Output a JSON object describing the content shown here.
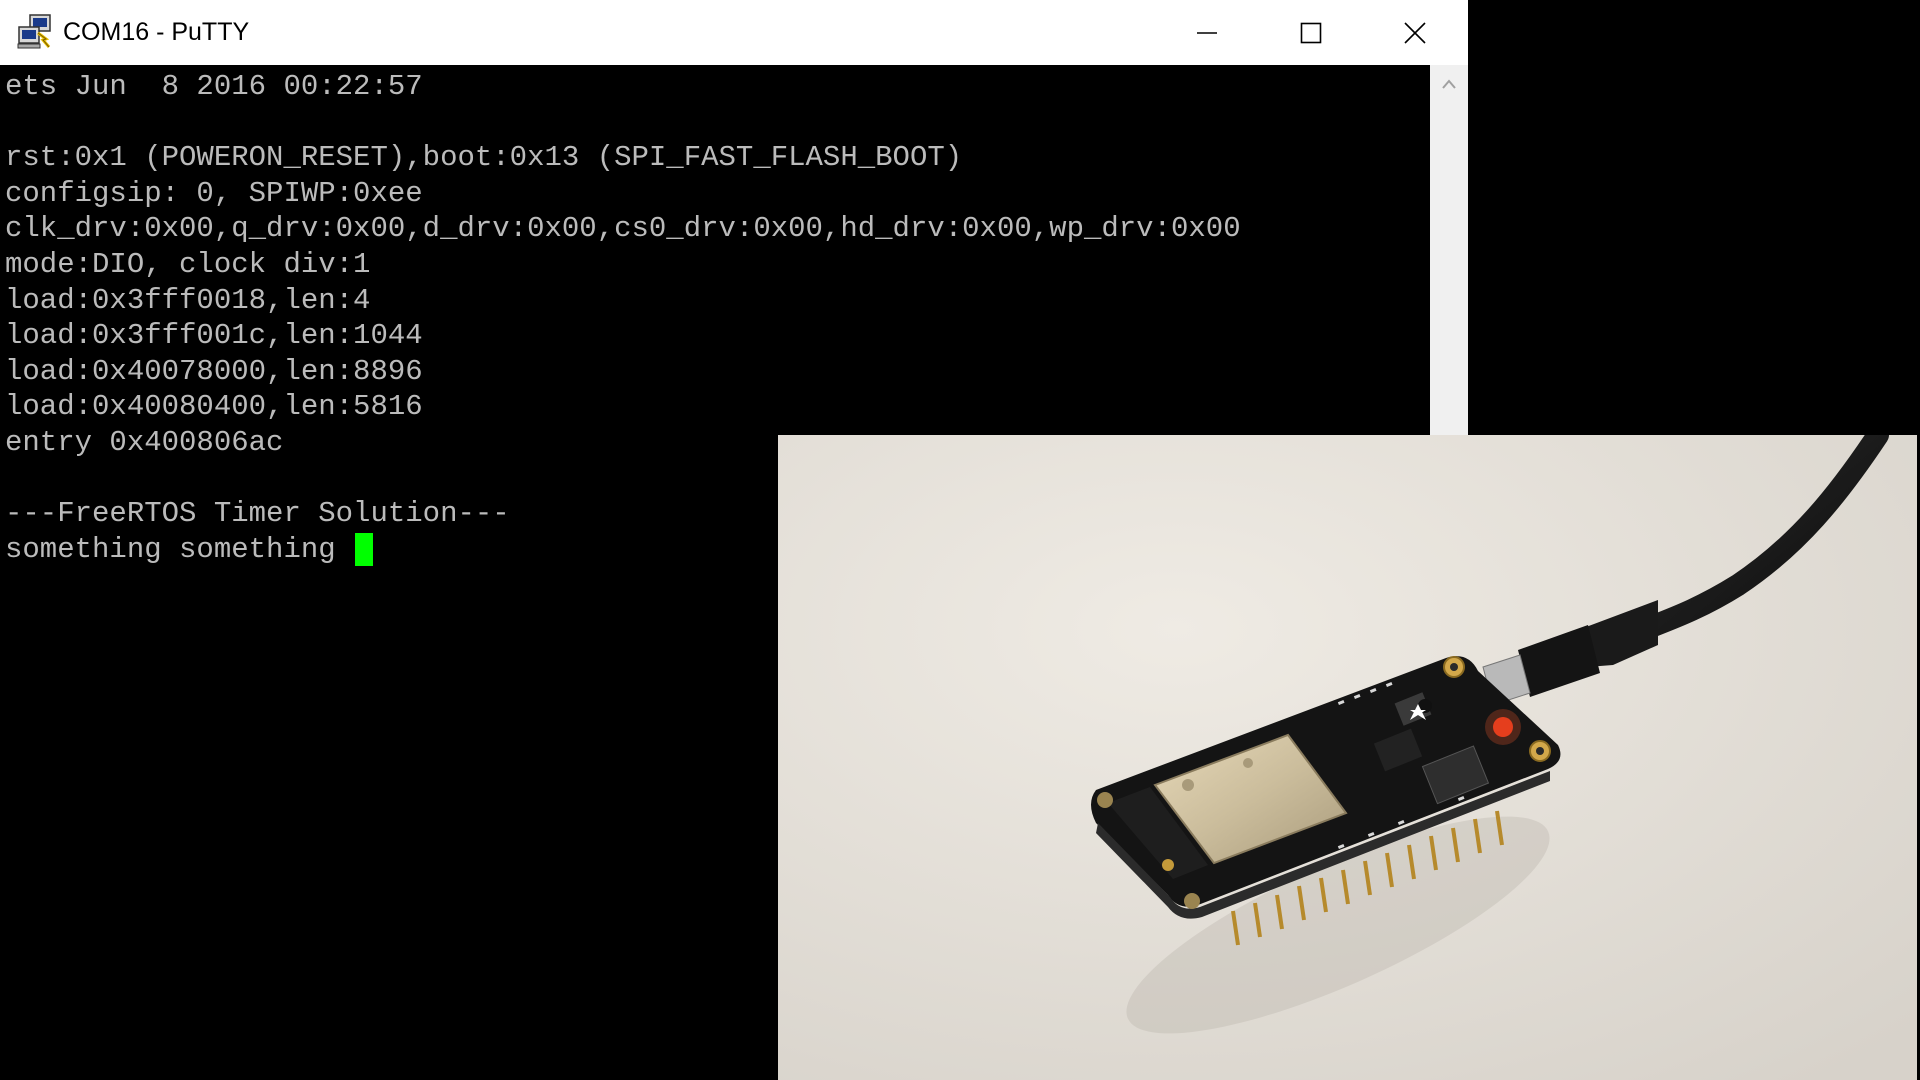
{
  "window": {
    "title": "COM16 - PuTTY",
    "icons": {
      "app": "putty-icon",
      "minimize": "minimize-icon",
      "maximize": "maximize-icon",
      "close": "close-icon",
      "scroll_up": "chevron-up-icon"
    }
  },
  "terminal": {
    "lines": [
      "ets Jun  8 2016 00:22:57",
      "",
      "rst:0x1 (POWERON_RESET),boot:0x13 (SPI_FAST_FLASH_BOOT)",
      "configsip: 0, SPIWP:0xee",
      "clk_drv:0x00,q_drv:0x00,d_drv:0x00,cs0_drv:0x00,hd_drv:0x00,wp_drv:0x00",
      "mode:DIO, clock div:1",
      "load:0x3fff0018,len:4",
      "load:0x3fff001c,len:1044",
      "load:0x40078000,len:8896",
      "load:0x40080400,len:5816",
      "entry 0x400806ac",
      "",
      "---FreeRTOS Timer Solution---",
      "something something "
    ],
    "text_color": "#bbbbbb",
    "background_color": "#000000",
    "cursor_color": "#00ff00"
  },
  "video_overlay": {
    "subject": "esp32-feather-board-photo"
  }
}
